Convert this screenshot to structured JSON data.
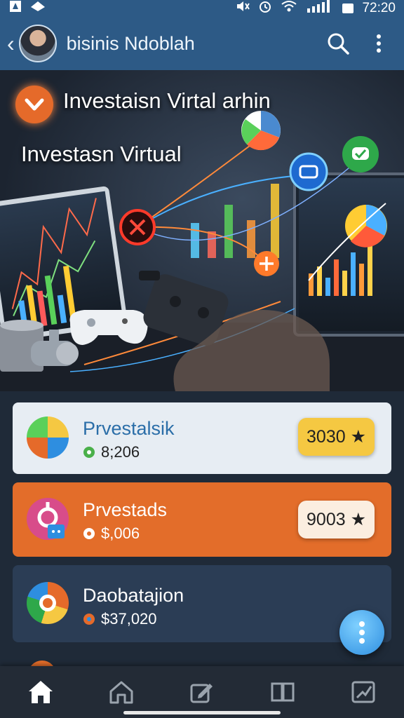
{
  "status_bar": {
    "time": "72:20",
    "left_icons": [
      "notification-icon",
      "app-icon"
    ],
    "right_icons": [
      "mute-icon",
      "alarm-icon",
      "wifi-icon",
      "signal-icon",
      "battery-icon"
    ]
  },
  "app_bar": {
    "title": "bisinis Ndoblah",
    "back_icon": "chevron-left-icon",
    "search_icon": "search-icon",
    "menu_icon": "more-vert-icon"
  },
  "hero": {
    "title": "Investaisn Virtal arhin",
    "subtitle": "Investasn Virtual"
  },
  "cards": [
    {
      "title": "Prvestalsik",
      "sub": "8;206",
      "badge": "3030 ★",
      "bg": "#e7edf3",
      "text_color": "#2b6ea8",
      "sub_color": "#222",
      "pill_bg": "#f5c842"
    },
    {
      "title": "Prvestads",
      "sub": "$,006",
      "badge": "9003 ★",
      "bg": "#e36d2a",
      "text_color": "#ffffff",
      "sub_color": "#ffffff",
      "pill_bg": "#fbeee0"
    },
    {
      "title": "Daobatajion",
      "sub": "$37,020",
      "badge": "",
      "bg": "#2b3d55",
      "text_color": "#ffffff",
      "sub_color": "#ffffff",
      "pill_bg": ""
    }
  ],
  "bottom_nav": [
    {
      "icon": "home-icon",
      "active": true
    },
    {
      "icon": "house-icon",
      "active": false
    },
    {
      "icon": "edit-icon",
      "active": false
    },
    {
      "icon": "book-icon",
      "active": false
    },
    {
      "icon": "chart-icon",
      "active": false
    }
  ],
  "colors": {
    "app_bar": "#2d5a86",
    "accent_orange": "#e36d2a",
    "fab": "#2e8ee0",
    "nav_bg": "#232b36"
  }
}
